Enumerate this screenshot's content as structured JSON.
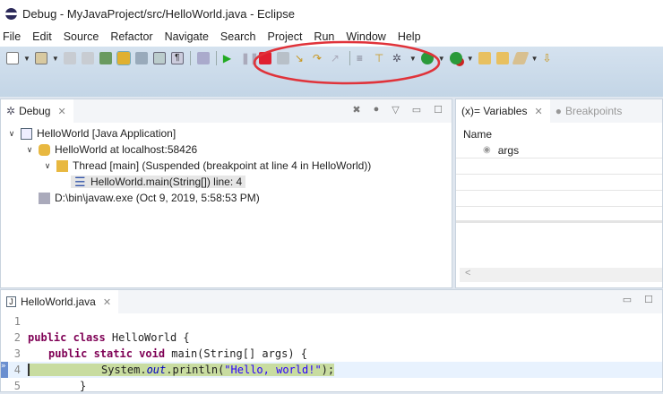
{
  "window": {
    "title": "Debug - MyJavaProject/src/HelloWorld.java - Eclipse"
  },
  "menu": [
    "File",
    "Edit",
    "Source",
    "Refactor",
    "Navigate",
    "Search",
    "Project",
    "Run",
    "Window",
    "Help"
  ],
  "debug_view": {
    "tab_label": "Debug",
    "tree": [
      {
        "label": "HelloWorld [Java Application]"
      },
      {
        "label": "HelloWorld at localhost:58426"
      },
      {
        "label": "Thread [main] (Suspended (breakpoint at line 4 in HelloWorld))"
      },
      {
        "label": "HelloWorld.main(String[]) line: 4"
      },
      {
        "label": "D:\\bin\\javaw.exe (Oct 9, 2019, 5:58:53 PM)"
      }
    ]
  },
  "variables_view": {
    "tab_label": "(x)= Variables",
    "other_tab": "Breakpoints",
    "column": "Name",
    "rows": [
      "args"
    ]
  },
  "editor": {
    "tab_label": "HelloWorld.java",
    "lines": [
      {
        "n": "1"
      },
      {
        "n": "2",
        "kw": "public class ",
        "rest": "HelloWorld {"
      },
      {
        "n": "3",
        "kw": "public static void ",
        "rest": "main(String[] args) {"
      },
      {
        "n": "4",
        "a": "System.",
        "fld": "out",
        "b": ".println(",
        "str": "\"Hello, world!\"",
        "c": ");"
      },
      {
        "n": "5",
        "rest": "}"
      }
    ]
  },
  "colors": {
    "highlight": "#c8dca0",
    "annotation": "#e0333a"
  }
}
